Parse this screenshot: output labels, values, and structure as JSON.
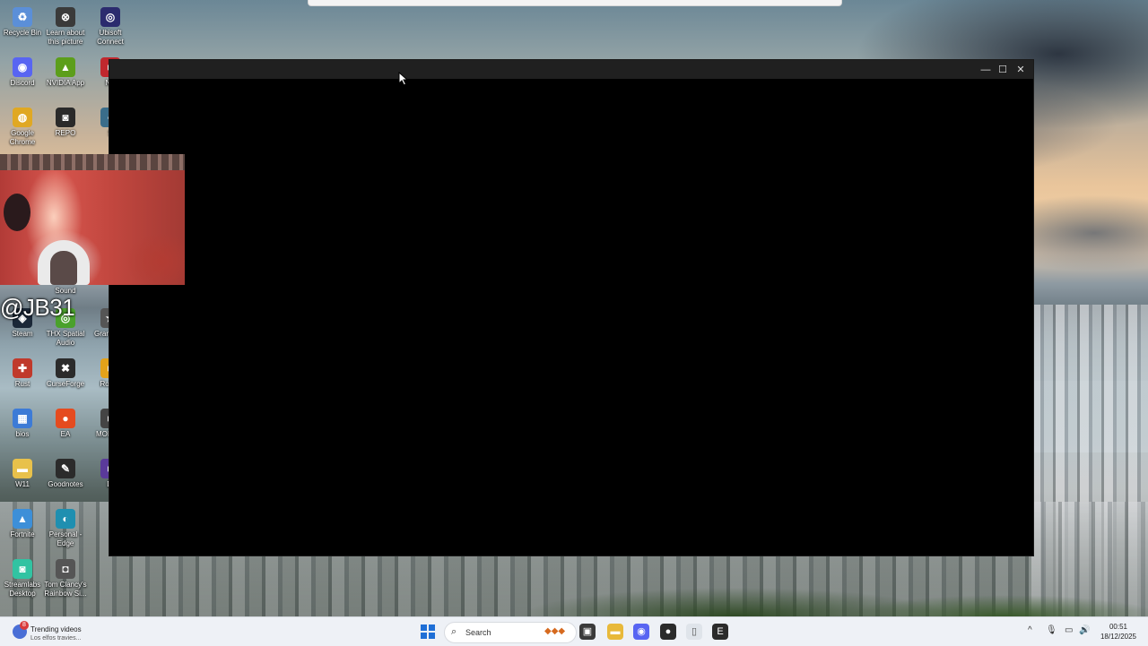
{
  "desktop": {
    "icons": [
      {
        "label": "Recycle Bin",
        "glyph": "♻",
        "color": "#5b8fd8"
      },
      {
        "label": "Learn about this picture",
        "glyph": "⊗",
        "color": "#3a3a3a"
      },
      {
        "label": "Ubisoft Connect",
        "glyph": "◎",
        "color": "#2b2b6e"
      },
      {
        "label": "Discord",
        "glyph": "◉",
        "color": "#5865f2"
      },
      {
        "label": "NVIDIA App",
        "glyph": "▲",
        "color": "#5c9e1b"
      },
      {
        "label": "NE",
        "glyph": "■",
        "color": "#c0282e"
      },
      {
        "label": "Google Chrome",
        "glyph": "◍",
        "color": "#e0a823"
      },
      {
        "label": "REPO",
        "glyph": "◙",
        "color": "#2a2a2a"
      },
      {
        "label": "S",
        "glyph": "◐",
        "color": "#3a6d8a"
      },
      {
        "label": "Sound",
        "glyph": "♪",
        "color": "#444444"
      },
      {
        "label": "Steam",
        "glyph": "◈",
        "color": "#1b2838"
      },
      {
        "label": "THX Spatial Audio",
        "glyph": "◎",
        "color": "#4aa12b"
      },
      {
        "label": "Gran Auto",
        "glyph": "★",
        "color": "#555555"
      },
      {
        "label": "Rust",
        "glyph": "✚",
        "color": "#c0392b"
      },
      {
        "label": "CurseForge",
        "glyph": "✖",
        "color": "#2b2b2b"
      },
      {
        "label": "Ro Ga",
        "glyph": "■",
        "color": "#e3a21a"
      },
      {
        "label": "bios",
        "glyph": "▦",
        "color": "#3d7bd6"
      },
      {
        "label": "EA",
        "glyph": "●",
        "color": "#e54b1f"
      },
      {
        "label": "MON SH",
        "glyph": "■",
        "color": "#444444"
      },
      {
        "label": "W11",
        "glyph": "▬",
        "color": "#e8c14b"
      },
      {
        "label": "Goodnotes",
        "glyph": "✎",
        "color": "#2b2b2b"
      },
      {
        "label": "Di",
        "glyph": "■",
        "color": "#5a3a9a"
      },
      {
        "label": "Fortnite",
        "glyph": "▲",
        "color": "#3d8fd8"
      },
      {
        "label": "Personal - Edge",
        "glyph": "◐",
        "color": "#1f8fb0"
      },
      {
        "label": "Streamlabs Desktop",
        "glyph": "◙",
        "color": "#31c3a2"
      },
      {
        "label": "Tom Clancy's Rainbow Si...",
        "glyph": "◘",
        "color": "#555555"
      }
    ]
  },
  "webcam": {
    "watermark": "@JB31"
  },
  "window": {
    "title": "",
    "minimize_glyph": "—",
    "maximize_glyph": "☐",
    "close_glyph": "✕"
  },
  "taskbar": {
    "widget": {
      "badge": "8",
      "title": "Trending videos",
      "subtitle": "Los elfos travies..."
    },
    "search": {
      "placeholder": "Search"
    },
    "apps": [
      {
        "name": "task-view",
        "glyph": "▣",
        "color": "#3a3a3a"
      },
      {
        "name": "file-explorer",
        "glyph": "▬",
        "color": "#e8b93a"
      },
      {
        "name": "discord",
        "glyph": "◉",
        "color": "#5865f2"
      },
      {
        "name": "obs",
        "glyph": "●",
        "color": "#2b2b2b"
      },
      {
        "name": "notepad",
        "glyph": "▯",
        "color": "#dfe4ea"
      },
      {
        "name": "epic-games",
        "glyph": "E",
        "color": "#2b2b2b"
      }
    ],
    "tray": {
      "chevron": "^",
      "mic": "🎙",
      "network": "▭",
      "volume": "🔊"
    },
    "clock": {
      "time": "00:51",
      "date": "18/12/2025"
    }
  }
}
